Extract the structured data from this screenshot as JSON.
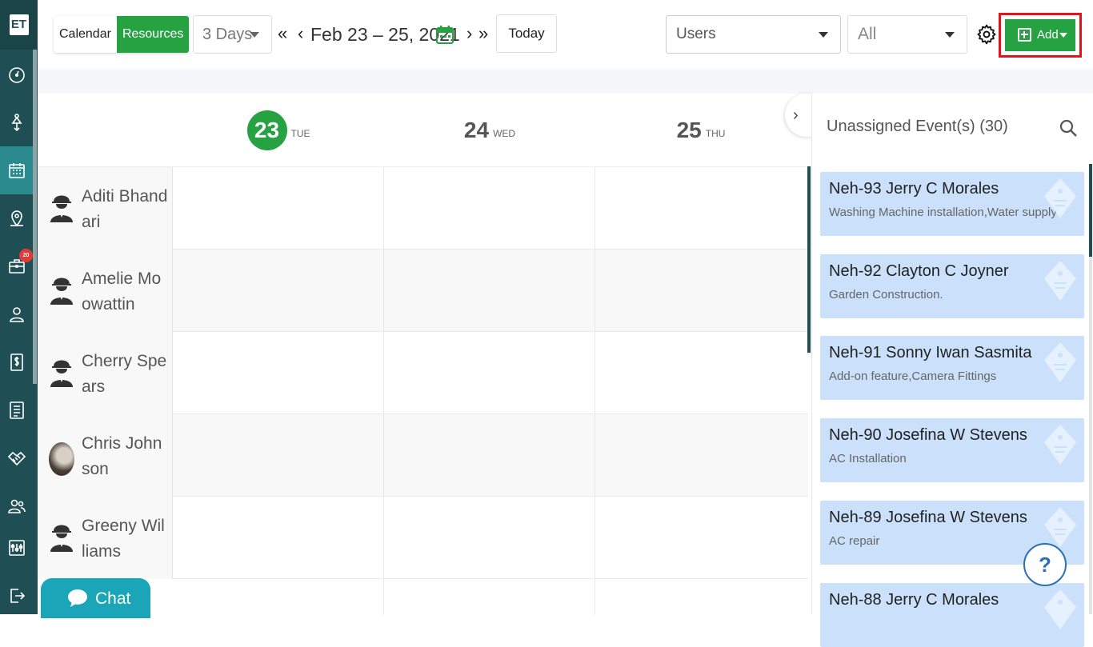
{
  "app": {
    "logo": "ET"
  },
  "sidebar": {
    "items": [
      {
        "icon": "dashboard-icon"
      },
      {
        "icon": "dispatch-icon"
      },
      {
        "icon": "calendar-icon",
        "active": true
      },
      {
        "icon": "map-pin-icon"
      },
      {
        "icon": "jobs-briefcase-icon",
        "badge": "20"
      },
      {
        "icon": "user-icon"
      },
      {
        "icon": "invoice-dollar-icon"
      },
      {
        "icon": "list-icon"
      },
      {
        "icon": "handshake-icon"
      },
      {
        "icon": "team-icon"
      },
      {
        "icon": "settings-sliders-icon"
      },
      {
        "icon": "logout-icon"
      }
    ]
  },
  "toolbar": {
    "view_calendar": "Calendar",
    "view_resources": "Resources",
    "days_select": "3 Days",
    "date_range": "Feb 23 – 25, 2021",
    "today": "Today",
    "users_select": "Users",
    "all_select": "All",
    "add": "Add"
  },
  "schedule": {
    "days": [
      {
        "num": "23",
        "name": "TUE",
        "today": true
      },
      {
        "num": "24",
        "name": "WED"
      },
      {
        "num": "25",
        "name": "THU"
      }
    ],
    "resources": [
      {
        "name": "Aditi Bhandari",
        "avatar": "worker-icon"
      },
      {
        "name": "Amelie Moowattin",
        "avatar": "worker-icon"
      },
      {
        "name": "Cherry Spears",
        "avatar": "worker-icon"
      },
      {
        "name": "Chris Johnson",
        "avatar": "photo"
      },
      {
        "name": "Greeny Williams",
        "avatar": "worker-icon"
      }
    ]
  },
  "panel": {
    "title": "Unassigned Event(s) (30)",
    "events": [
      {
        "title": "Neh-93 Jerry C Morales",
        "desc": "Washing Machine installation,Water supply"
      },
      {
        "title": "Neh-92 Clayton C Joyner",
        "desc": "Garden Construction."
      },
      {
        "title": "Neh-91 Sonny Iwan Sasmita",
        "desc": "Add-on feature,Camera Fittings"
      },
      {
        "title": "Neh-90 Josefina W Stevens",
        "desc": "AC Installation"
      },
      {
        "title": "Neh-89 Josefina W Stevens",
        "desc": "AC repair"
      },
      {
        "title": "Neh-88 Jerry C Morales",
        "desc": ""
      }
    ],
    "help": "?"
  },
  "chat": {
    "label": "Chat"
  },
  "colors": {
    "primary_green": "#27a243",
    "sidebar": "#1f4f54",
    "event_card": "#cbe1fb",
    "highlight": "#e2151b"
  }
}
